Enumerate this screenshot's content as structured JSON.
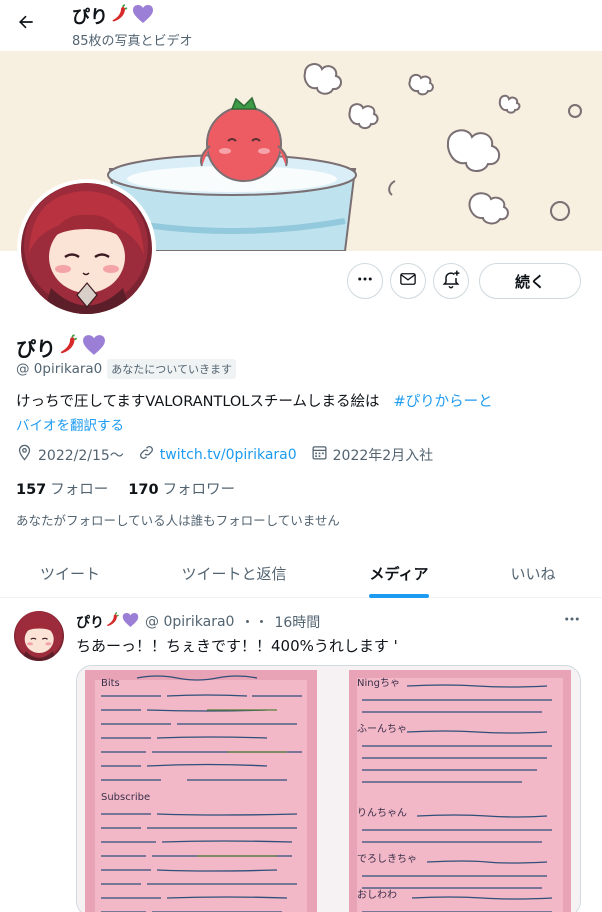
{
  "header": {
    "name": "ぴり",
    "subtitle": "85枚の写真とビデオ"
  },
  "buttons": {
    "follow_label": "続く"
  },
  "profile": {
    "name": "ぴり",
    "handle": "@ 0pirikara0",
    "follows_you_badge": "あなたについていきます",
    "bio": "けっちで圧してますVALORANTLOLスチームしまる絵は",
    "bio_hashtag": "#ぴりからーと",
    "translate_bio": "バイオを翻訳する",
    "date": "2022/2/15〜",
    "link": "twitch.tv/0pirikara0",
    "joined": "2022年2月入社",
    "following_count": "157",
    "following_label": "フォロー",
    "followers_count": "170",
    "followers_label": "フォロワー",
    "mutuals_note": "あなたがフォローしている人は誰もフォローしていません"
  },
  "tabs": [
    {
      "label": "ツイート",
      "active": false
    },
    {
      "label": "ツイートと返信",
      "active": false
    },
    {
      "label": "メディア",
      "active": true
    },
    {
      "label": "いいね",
      "active": false
    }
  ],
  "tweet": {
    "name": "ぴり",
    "handle": "@ 0pirikara0",
    "separator": "・・",
    "time": "16時間",
    "text": "ちあーっ！！ちぇきです！！400%うれします '",
    "media_left_heading_1": "Bits",
    "media_left_heading_2": "Subscribe",
    "media_right_names": [
      "Ningちゃ",
      "ふーんちゃ",
      "りんちゃん",
      "でろしきちゃ",
      "おしわわ"
    ]
  },
  "icons": {
    "back": "arrow-left-icon",
    "more": "more-horizontal-icon",
    "message": "envelope-icon",
    "notify": "bell-plus-icon",
    "location": "location-pin-icon",
    "link": "link-icon",
    "calendar": "calendar-icon",
    "chili": "chili-pepper-emoji",
    "heart": "purple-heart-emoji"
  },
  "colors": {
    "accent": "#1d9bf0",
    "text": "#0f1419",
    "secondary": "#536471",
    "border": "#cfd9de",
    "heart": "#9b7fd6",
    "chili": "#d62a2a"
  }
}
